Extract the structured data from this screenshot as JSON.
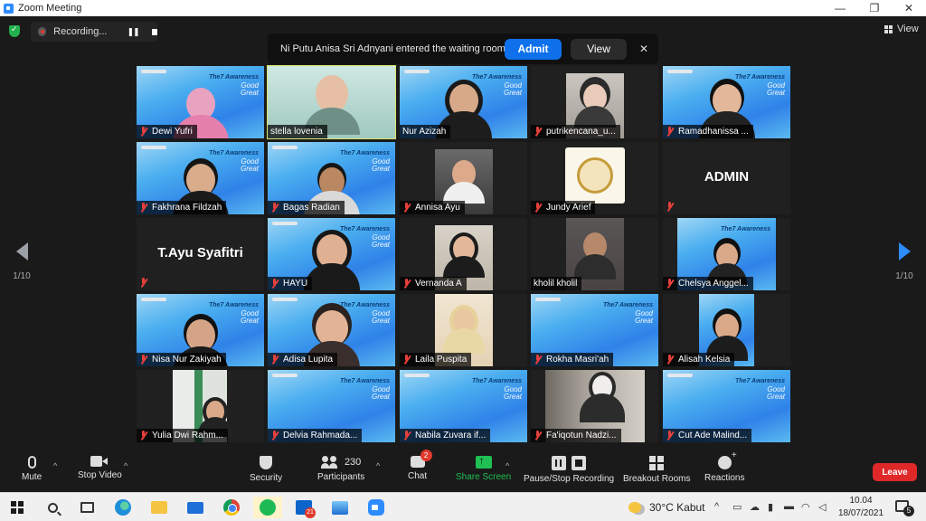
{
  "window": {
    "title": "Zoom Meeting",
    "minimize": "—",
    "maximize": "❐",
    "close": "✕"
  },
  "recording": {
    "label": "Recording..."
  },
  "notification": {
    "message": "Ni Putu Anisa Sri Adnyani entered the waiting room",
    "admit": "Admit",
    "view": "View",
    "close": "✕"
  },
  "view_button": {
    "label": "View"
  },
  "pager": {
    "left": "1/10",
    "right": "1/10"
  },
  "participants": [
    "Dewi Yufri",
    "stella lovenia",
    "Nur Azizah",
    "putrikencana_u...",
    "Ramadhanissa ...",
    "Fakhrana Fildzah",
    "Bagas Radian",
    "Annisa Ayu",
    "Jundy Arief",
    "ADMIN",
    "T.Ayu Syafitri",
    "HAYU",
    "Vernanda A",
    "kholil kholil",
    "Chelsya Anggel...",
    "Nisa Nur Zakiyah",
    "Adisa Lupita",
    "Laila Puspita",
    "Rokha Masri'ah",
    "Alisah Kelsia",
    "Yulia Dwi Rahm...",
    "Delvia Rahmada...",
    "Nabila Zuvara if...",
    "Fa'iqotun Nadzi...",
    "Cut Ade Malind..."
  ],
  "banner": {
    "title": "The7 Awareness",
    "good": "Good",
    "great": "Great"
  },
  "toolbar": {
    "mute": "Mute",
    "stop_video": "Stop Video",
    "security": "Security",
    "participants": "Participants",
    "participants_count": "230",
    "chat": "Chat",
    "chat_badge": "2",
    "share_screen": "Share Screen",
    "pause_stop_recording": "Pause/Stop Recording",
    "breakout_rooms": "Breakout Rooms",
    "reactions": "Reactions",
    "leave": "Leave"
  },
  "taskbar": {
    "mail_badge": "21",
    "weather": "30°C  Kabut",
    "time": "10.04",
    "date": "18/07/2021",
    "notif_count": "5"
  },
  "colors": {
    "accent": "#0e71eb",
    "leave": "#e02828",
    "share": "#1fbf53",
    "speaker_outline": "#d9e36c"
  }
}
